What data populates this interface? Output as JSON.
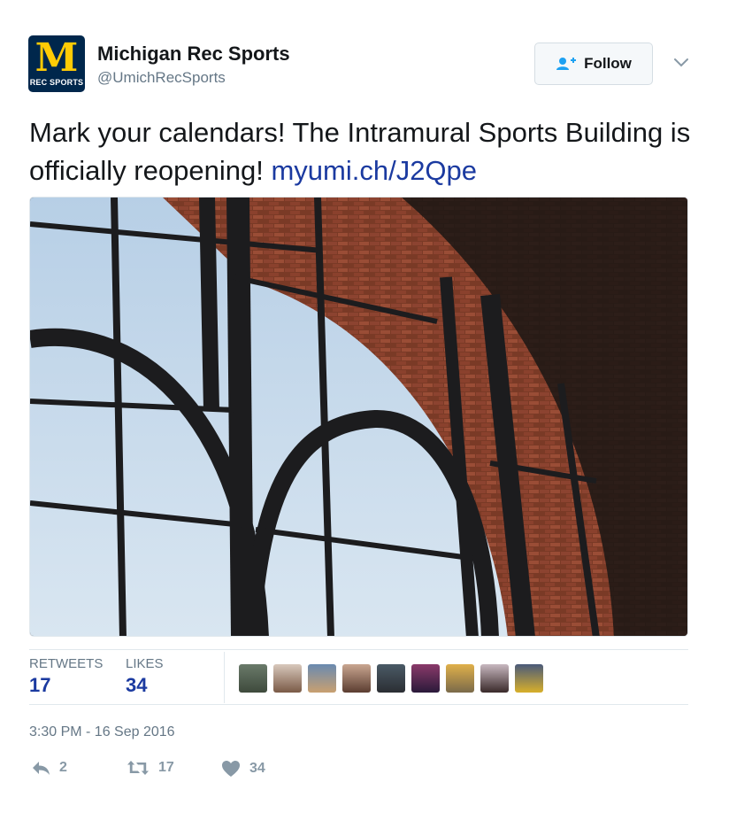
{
  "account": {
    "display_name": "Michigan Rec Sports",
    "handle": "@UmichRecSports",
    "avatar_letter": "M",
    "avatar_caption": "REC SPORTS",
    "avatar_bg": "#00274c",
    "avatar_accent": "#ffcb05"
  },
  "header": {
    "follow_label": "Follow",
    "follow_icon": "add-user-icon",
    "more_icon": "chevron-down-icon"
  },
  "tweet": {
    "text": "Mark your calendars! The Intramural Sports Building is officially reopening!",
    "link": "myumi.ch/J2Qpe",
    "link_color": "#1b3aa0"
  },
  "media": {
    "description_icon": "photo"
  },
  "stats": {
    "retweets_label": "RETWEETS",
    "retweets_count": "17",
    "likes_label": "LIKES",
    "likes_count": "34",
    "value_color": "#1b3aa0"
  },
  "likers": {
    "count_shown": 9
  },
  "timestamp": "3:30 PM - 16 Sep 2016",
  "actions": {
    "reply_count": "2",
    "retweet_count": "17",
    "like_count": "34",
    "reply_icon": "reply-icon",
    "retweet_icon": "retweet-icon",
    "like_icon": "heart-icon"
  }
}
